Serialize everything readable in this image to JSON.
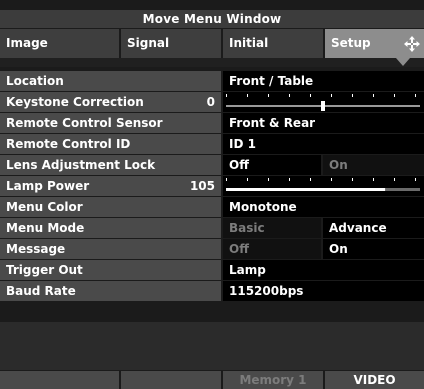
{
  "window": {
    "title": "Move Menu Window"
  },
  "tabs": [
    {
      "label": "Image",
      "active": false
    },
    {
      "label": "Signal",
      "active": false
    },
    {
      "label": "Initial",
      "active": false
    },
    {
      "label": "Setup",
      "active": true
    }
  ],
  "rows": {
    "location": {
      "label": "Location",
      "value": "Front / Table"
    },
    "keystone": {
      "label": "Keystone Correction",
      "number": "0",
      "level": 0.5
    },
    "remote_sensor": {
      "label": "Remote Control Sensor",
      "value": "Front & Rear"
    },
    "remote_id": {
      "label": "Remote Control ID",
      "value": "ID 1"
    },
    "lens_lock": {
      "label": "Lens Adjustment Lock",
      "selected": "Off",
      "other": "On"
    },
    "lamp_power": {
      "label": "Lamp Power",
      "number": "105",
      "level": 0.82
    },
    "menu_color": {
      "label": "Menu Color",
      "value": "Monotone"
    },
    "menu_mode": {
      "label": "Menu Mode",
      "option1": "Basic",
      "option2": "Advance",
      "selected": "Advance"
    },
    "message": {
      "label": "Message",
      "option1": "Off",
      "option2": "On",
      "selected": "On"
    },
    "trigger_out": {
      "label": "Trigger Out",
      "value": "Lamp"
    },
    "baud_rate": {
      "label": "Baud Rate",
      "value": "115200bps"
    }
  },
  "footer": {
    "memory": "Memory 1",
    "source": "VIDEO"
  },
  "colors": {
    "panel": "#1b1b1b",
    "label_bg": "#4a4a4a",
    "value_bg": "#000000",
    "active_tab": "#8d8d8d",
    "dim_text": "#7c7c7c"
  },
  "icons": {
    "move": "four-arrows-move-icon"
  }
}
